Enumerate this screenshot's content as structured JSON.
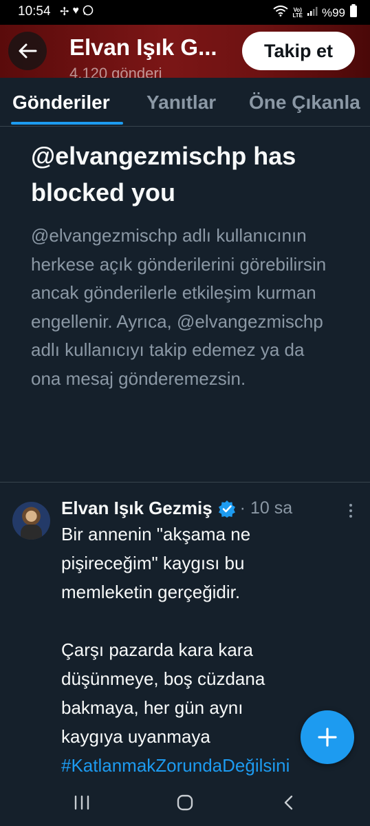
{
  "status_bar": {
    "time": "10:54",
    "left_icons": [
      "pinwheel-icon",
      "heart-icon",
      "whatsapp-icon"
    ],
    "network_label_top": "Vo)",
    "network_label_bottom": "LTE",
    "battery": "%99"
  },
  "header": {
    "title": "Elvan Işık G...",
    "subtitle": "4.120 gönderi",
    "follow_label": "Takip et",
    "banner_color": "#7b1616"
  },
  "tabs": [
    {
      "label": "Gönderiler",
      "active": true
    },
    {
      "label": "Yanıtlar",
      "active": false
    },
    {
      "label": "Öne Çıkanla",
      "active": false
    }
  ],
  "blocked": {
    "title": "@elvangezmischp has blocked you",
    "body": "@elvangezmischp adlı kullanıcının herkese açık gönderilerini görebilirsin ancak gönderilerle etkileşim kurman engellenir. Ayrıca, @elvangezmischp adlı kullanıcıyı takip edemez ya da ona mesaj gönderemezsin."
  },
  "tweet": {
    "author": "Elvan Işık Gezmiş",
    "time": "· 10 sa",
    "lines": [
      "Bir annenin \"akşama ne",
      "pişireceğim\" kaygısı bu",
      "memleketin gerçeğidir.",
      "",
      "Çarşı pazarda kara kara",
      "düşünmeye, boş cüzdana",
      "bakmaya, her gün aynı",
      "kaygıya uyanmaya"
    ],
    "hashtag": "#KatlanmakZorundaDeğilsini"
  },
  "colors": {
    "background": "#15202b",
    "accent": "#1d9bf0",
    "muted_text": "#8b98a5",
    "divider": "#38444d"
  }
}
